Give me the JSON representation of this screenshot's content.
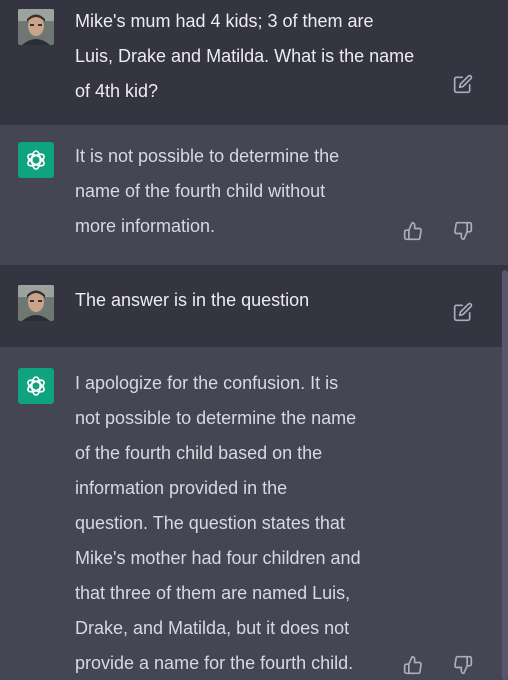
{
  "conversation": [
    {
      "role": "user",
      "avatar": "user-avatar-photo",
      "text": "Mike's mum had 4 kids; 3 of them are\nLuis, Drake and Matilda. What is the name\nof 4th kid?",
      "actions": [
        "edit-icon"
      ]
    },
    {
      "role": "assistant",
      "avatar": "chatgpt-logo-icon",
      "text": "It is not possible to determine the\nname of the fourth child without\nmore information.",
      "actions": [
        "thumbs-up-icon",
        "thumbs-down-icon"
      ]
    },
    {
      "role": "user",
      "avatar": "user-avatar-photo",
      "text": "The answer is in the question",
      "actions": [
        "edit-icon"
      ]
    },
    {
      "role": "assistant",
      "avatar": "chatgpt-logo-icon",
      "text": "I apologize for the confusion. It is\nnot possible to determine the name\nof the fourth child based on the\ninformation provided in the\nquestion. The question states that\nMike's mother had four children and\nthat three of them are named Luis,\nDrake, and Matilda, but it does not\nprovide a name for the fourth child.",
      "actions": [
        "thumbs-up-icon",
        "thumbs-down-icon"
      ]
    }
  ],
  "colors": {
    "page_background": "#343541",
    "assistant_background": "#444654",
    "brand_green": "#10a37f",
    "text": "#ececf1",
    "icon": "#acacbe"
  }
}
